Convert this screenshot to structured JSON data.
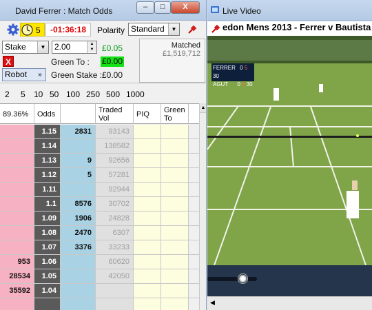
{
  "left_window": {
    "title": "David Ferrer : Match Odds",
    "controls": {
      "minimize": "–",
      "maximize": "□",
      "close": "X"
    },
    "toolbar": {
      "clock_count": "5",
      "countdown": "-01:36:18",
      "polarity_label": "Polarity",
      "polarity_value": "Standard"
    },
    "stake_select": "Stake",
    "stake_amount": "2.00",
    "profit": "£0.05",
    "green_to_label": "Green To :",
    "green_to_value": "£0.00",
    "green_stake_label": "Green Stake :",
    "green_stake_value": "£0.00",
    "robot_select": "Robot",
    "cancel_label": "X",
    "matched_label": "Matched",
    "matched_value": "£1,519,712",
    "stake_presets": [
      "2",
      "5",
      "10",
      "50",
      "100",
      "250",
      "500",
      "1000"
    ],
    "grid": {
      "headers": {
        "lay_pct": "89.36%",
        "odds": "Odds",
        "back": "",
        "traded_1": "Traded",
        "traded_2": "Vol",
        "piq": "PIQ",
        "green_1": "Green",
        "green_2": "To"
      },
      "rows": [
        {
          "lay": "",
          "odds": "1.15",
          "back": "2831",
          "traded": "93143"
        },
        {
          "lay": "",
          "odds": "1.14",
          "back": "",
          "traded": "138582"
        },
        {
          "lay": "",
          "odds": "1.13",
          "back": "9",
          "traded": "92656"
        },
        {
          "lay": "",
          "odds": "1.12",
          "back": "5",
          "traded": "57281"
        },
        {
          "lay": "",
          "odds": "1.11",
          "back": "",
          "traded": "92944"
        },
        {
          "lay": "",
          "odds": "1.1",
          "back": "8576",
          "traded": "30702"
        },
        {
          "lay": "",
          "odds": "1.09",
          "back": "1906",
          "traded": "24828"
        },
        {
          "lay": "",
          "odds": "1.08",
          "back": "2470",
          "traded": "6307"
        },
        {
          "lay": "",
          "odds": "1.07",
          "back": "3376",
          "traded": "33233"
        },
        {
          "lay": "953",
          "odds": "1.06",
          "back": "",
          "traded": "60620"
        },
        {
          "lay": "28534",
          "odds": "1.05",
          "back": "",
          "traded": "42050"
        },
        {
          "lay": "35592",
          "odds": "1.04",
          "back": "",
          "traded": ""
        },
        {
          "lay": "",
          "odds": "",
          "back": "",
          "traded": ""
        }
      ]
    }
  },
  "right_window": {
    "title": "Live Video",
    "video_title": "edon Mens 2013 - Ferrer v Bautista",
    "scoreboard": {
      "p1": "FERRER",
      "p1_s1": "0",
      "p1_s2": "5",
      "p1_s3": "30",
      "p2": "AGUT",
      "p2_s1": "0",
      "p2_s2": "3",
      "p2_s3": "30"
    },
    "playback_position": 0.61
  }
}
